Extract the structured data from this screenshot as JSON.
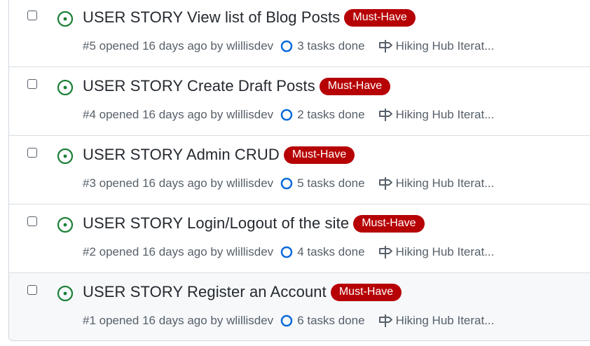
{
  "issues": [
    {
      "title": "USER STORY View list of Blog Posts",
      "label": "Must-Have",
      "meta": "#5 opened 16 days ago by wlillisdev",
      "tasks": "3 tasks done",
      "milestone": "Hiking Hub Iterat..."
    },
    {
      "title": "USER STORY Create Draft Posts",
      "label": "Must-Have",
      "meta": "#4 opened 16 days ago by wlillisdev",
      "tasks": "2 tasks done",
      "milestone": "Hiking Hub Iterat..."
    },
    {
      "title": "USER STORY Admin CRUD",
      "label": "Must-Have",
      "meta": "#3 opened 16 days ago by wlillisdev",
      "tasks": "5 tasks done",
      "milestone": "Hiking Hub Iterat..."
    },
    {
      "title": "USER STORY Login/Logout of the site",
      "label": "Must-Have",
      "meta": "#2 opened 16 days ago by wlillisdev",
      "tasks": "4 tasks done",
      "milestone": "Hiking Hub Iterat..."
    },
    {
      "title": "USER STORY Register an Account",
      "label": "Must-Have",
      "meta": "#1 opened 16 days ago by wlillisdev",
      "tasks": "6 tasks done",
      "milestone": "Hiking Hub Iterat..."
    }
  ],
  "colors": {
    "label_bg": "#b60205",
    "open_icon": "#1a7f37",
    "tasks_icon": "#0969da"
  },
  "icons": {
    "status": "issue-opened-icon",
    "tasks": "tasks-progress-icon",
    "milestone": "milestone-icon"
  }
}
